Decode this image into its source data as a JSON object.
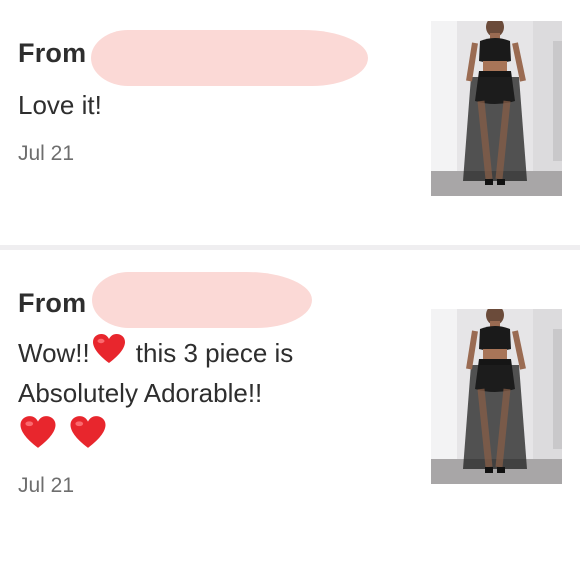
{
  "comments": [
    {
      "from_label": "From",
      "message": "Love it!",
      "date": "Jul 21",
      "icon": "heart-icon"
    },
    {
      "from_label": "From",
      "message_part1": "Wow!!",
      "message_part2": "this 3 piece is",
      "message_line2": "Absolutely Adorable!!",
      "date": "Jul 21",
      "icons": [
        "heart-icon",
        "heart-icon",
        "heart-icon"
      ]
    }
  ],
  "colors": {
    "redaction": "#fbd9d6",
    "heart": "#e8262d",
    "divider": "#efeef0",
    "text": "#2e2e2e",
    "date": "#6e6e6e"
  }
}
